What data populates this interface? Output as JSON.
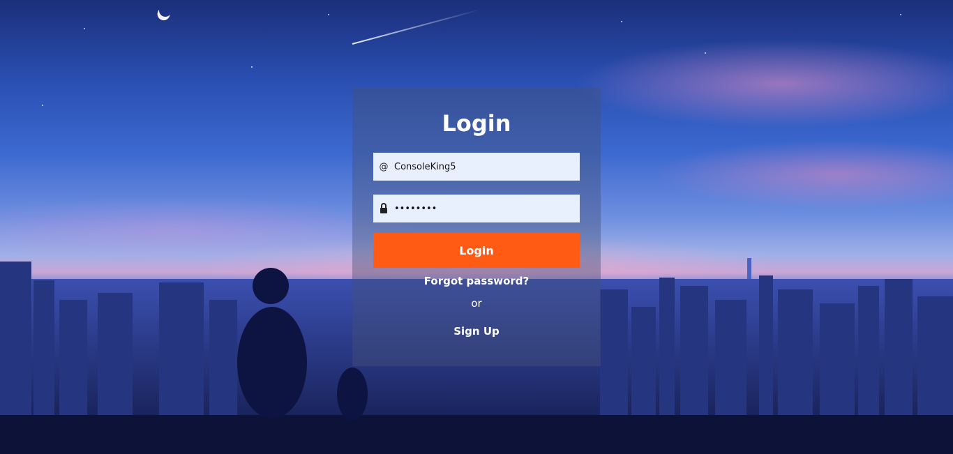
{
  "form": {
    "title": "Login",
    "username": {
      "value": "ConsoleKing5",
      "icon": "at-icon"
    },
    "password": {
      "value": "12345678",
      "icon": "lock-icon"
    },
    "login_label": "Login",
    "forgot_label": "Forgot password?",
    "or_label": "or",
    "signup_label": "Sign Up"
  },
  "colors": {
    "button": "#ff5b14",
    "field_bg": "#e8f0fe",
    "panel_bg": "rgba(70, 80, 120, 0.42)"
  }
}
